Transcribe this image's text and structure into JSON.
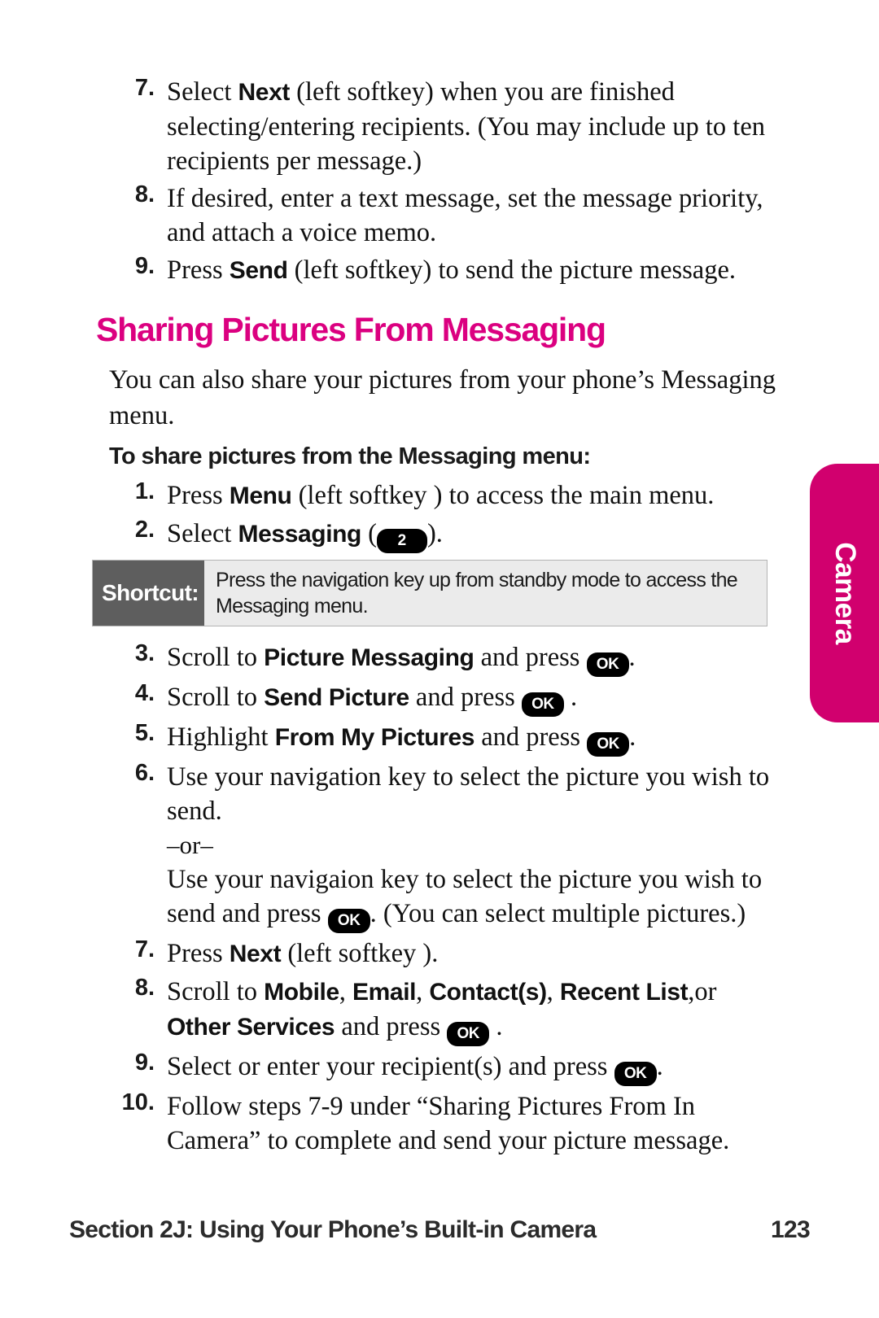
{
  "page": {
    "number": "123",
    "footer_title": "Section 2J: Using Your Phone’s Built-in Camera",
    "side_tab_label": "Camera",
    "accent_color": "#D1006E",
    "heading_color": "#DB0080"
  },
  "top_steps": [
    {
      "num": "7.",
      "parts": [
        {
          "t": "Select ",
          "b": false
        },
        {
          "t": "Next",
          "b": true
        },
        {
          "t": " (left softkey) when you are finished selecting/entering recipients. (You may include up to ten recipients per message.)",
          "b": false
        }
      ]
    },
    {
      "num": "8.",
      "parts": [
        {
          "t": "If desired, enter a text message, set the message priority, and attach a voice memo.",
          "b": false
        }
      ]
    },
    {
      "num": "9.",
      "parts": [
        {
          "t": "Press ",
          "b": false
        },
        {
          "t": "Send",
          "b": true
        },
        {
          "t": " (left softkey) to send the picture message.",
          "b": false
        }
      ]
    }
  ],
  "section": {
    "heading": "Sharing Pictures From Messaging",
    "intro": "You can also share your pictures from your phone’s Messaging menu.",
    "sub_heading": "To share pictures from the Messaging menu:"
  },
  "pre_shortcut_steps": [
    {
      "num": "1.",
      "parts": [
        {
          "t": "Press ",
          "b": false
        },
        {
          "t": "Menu",
          "b": true
        },
        {
          "t": " (left softkey ) to access the main menu.",
          "b": false
        }
      ]
    },
    {
      "num": "2.",
      "parts": [
        {
          "t": "Select ",
          "b": false
        },
        {
          "t": "Messaging",
          "b": true
        },
        {
          "t": " (",
          "b": false
        },
        {
          "key": "2",
          "kind": "num"
        },
        {
          "t": ").",
          "b": false
        }
      ]
    }
  ],
  "shortcut": {
    "label": "Shortcut:",
    "text": "Press the navigation key up from standby mode to access the Messaging menu."
  },
  "post_shortcut_steps": [
    {
      "num": "3.",
      "parts": [
        {
          "t": "Scroll to ",
          "b": false
        },
        {
          "t": "Picture Messaging",
          "b": true
        },
        {
          "t": " and press ",
          "b": false
        },
        {
          "key": "OK",
          "kind": "ok"
        },
        {
          "t": ".",
          "b": false
        }
      ]
    },
    {
      "num": "4.",
      "parts": [
        {
          "t": "Scroll to ",
          "b": false
        },
        {
          "t": "Send Picture",
          "b": true
        },
        {
          "t": " and press ",
          "b": false
        },
        {
          "key": "OK",
          "kind": "ok"
        },
        {
          "t": " .",
          "b": false
        }
      ]
    },
    {
      "num": "5.",
      "parts": [
        {
          "t": "Highlight ",
          "b": false
        },
        {
          "t": "From My Pictures",
          "b": true
        },
        {
          "t": " and press ",
          "b": false
        },
        {
          "key": "OK",
          "kind": "ok"
        },
        {
          "t": ".",
          "b": false
        }
      ]
    },
    {
      "num": "6.",
      "parts": [
        {
          "t": "Use your navigation key to select the picture you wish to send.",
          "b": false
        }
      ],
      "or_label": "–or–",
      "or_parts": [
        {
          "t": "Use your navigaion key to select the picture you wish to send and press ",
          "b": false
        },
        {
          "key": "OK",
          "kind": "ok"
        },
        {
          "t": ". (You can select multiple pictures.)",
          "b": false
        }
      ]
    },
    {
      "num": "7.",
      "parts": [
        {
          "t": "Press ",
          "b": false
        },
        {
          "t": "Next",
          "b": true
        },
        {
          "t": " (left softkey ).",
          "b": false
        }
      ]
    },
    {
      "num": "8.",
      "parts": [
        {
          "t": "Scroll to ",
          "b": false
        },
        {
          "t": "Mobile",
          "b": true
        },
        {
          "t": ", ",
          "b": false
        },
        {
          "t": "Email",
          "b": true
        },
        {
          "t": ", ",
          "b": false
        },
        {
          "t": "Contact(s)",
          "b": true
        },
        {
          "t": ", ",
          "b": false
        },
        {
          "t": "Recent List",
          "b": true
        },
        {
          "t": ",or ",
          "b": false
        },
        {
          "t": "Other Services",
          "b": true
        },
        {
          "t": " and press ",
          "b": false
        },
        {
          "key": "OK",
          "kind": "ok"
        },
        {
          "t": " .",
          "b": false
        }
      ]
    },
    {
      "num": "9.",
      "parts": [
        {
          "t": "Select or enter your recipient(s) and press ",
          "b": false
        },
        {
          "key": "OK",
          "kind": "ok"
        },
        {
          "t": ".",
          "b": false
        }
      ]
    },
    {
      "num": "10.",
      "parts": [
        {
          "t": "Follow steps 7-9 under “Sharing Pictures From In Camera” to complete and send your picture message.",
          "b": false
        }
      ]
    }
  ]
}
